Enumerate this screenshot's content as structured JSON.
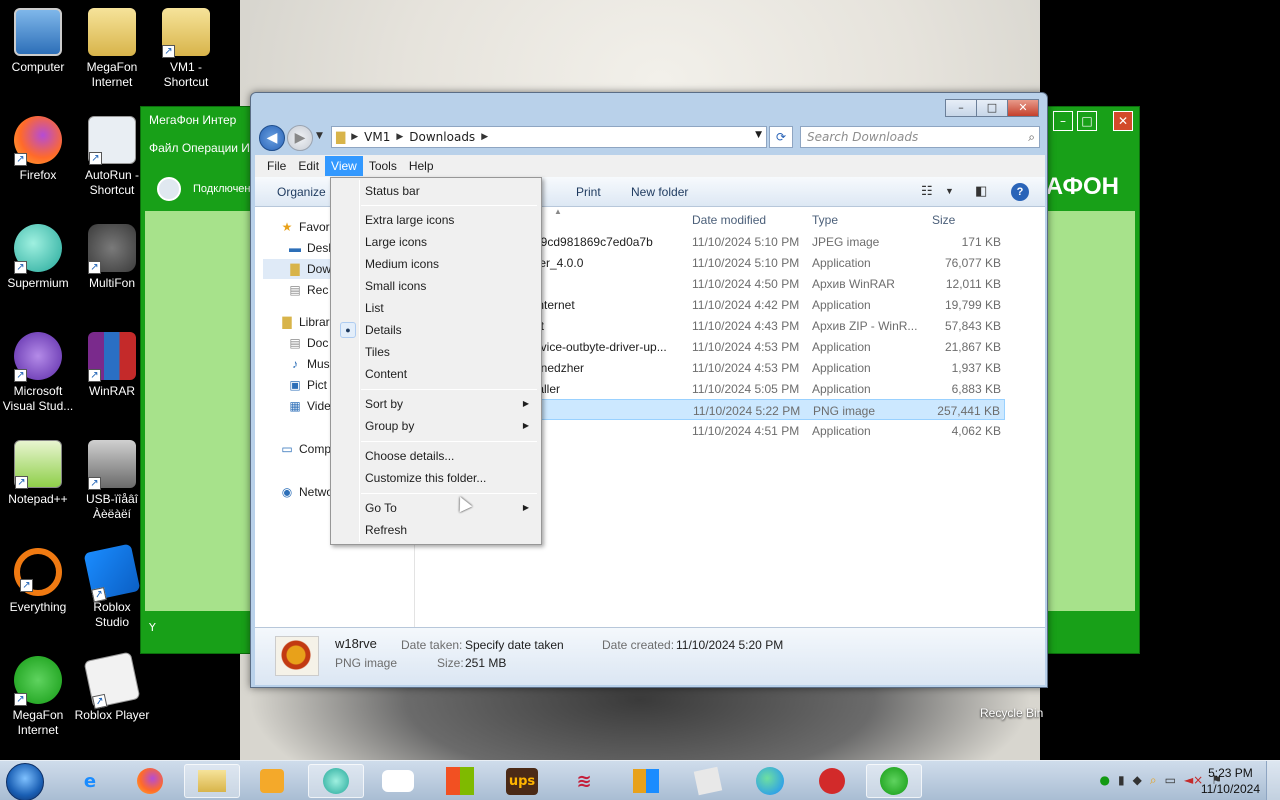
{
  "desktop": {
    "icons": [
      {
        "label1": "Computer",
        "label2": ""
      },
      {
        "label1": "MegaFon",
        "label2": "Internet"
      },
      {
        "label1": "VM1 -",
        "label2": "Shortcut"
      },
      {
        "label1": "Firefox",
        "label2": ""
      },
      {
        "label1": "AutoRun -",
        "label2": "Shortcut"
      },
      {
        "label1": "Supermium",
        "label2": ""
      },
      {
        "label1": "MultiFon",
        "label2": ""
      },
      {
        "label1": "Microsoft",
        "label2": "Visual Stud..."
      },
      {
        "label1": "WinRAR",
        "label2": ""
      },
      {
        "label1": "Notepad++",
        "label2": ""
      },
      {
        "label1": "USB-ïîåâî",
        "label2": "Àèëàëí"
      },
      {
        "label1": "Everything",
        "label2": ""
      },
      {
        "label1": "Roblox",
        "label2": "Studio"
      },
      {
        "label1": "MegaFon",
        "label2": "Internet"
      },
      {
        "label1": "Roblox Player",
        "label2": ""
      }
    ],
    "recycle_bin": "Recycle Bin"
  },
  "megafon_window": {
    "title": "МегаФон Интер",
    "menu": "Файл Операции И",
    "connect": "Подключен",
    "brand": "АФОН",
    "status": "Y"
  },
  "explorer": {
    "address": {
      "crumbs": [
        "VM1",
        "Downloads"
      ]
    },
    "search_placeholder": "Search Downloads",
    "menubar": [
      "File",
      "Edit",
      "View",
      "Tools",
      "Help"
    ],
    "toolbar": {
      "organize": "Organize",
      "print": "Print",
      "new_folder": "New folder"
    },
    "navpane": [
      "Favori",
      "Desl",
      "Dow",
      "Rec",
      "Librar",
      "Doc",
      "Mus",
      "Pict",
      "Vide",
      "Comp",
      "Netwo"
    ],
    "columns": {
      "date": "Date modified",
      "type": "Type",
      "size": "Size"
    },
    "files": [
      {
        "name": "e9cd981869c7ed0a7b",
        "date": "11/10/2024 5:10 PM",
        "type": "JPEG image",
        "size": "171 KB"
      },
      {
        "name": "ller_4.0.0",
        "date": "11/10/2024 5:10 PM",
        "type": "Application",
        "size": "76,077 KB"
      },
      {
        "name": "",
        "date": "11/10/2024 4:50 PM",
        "type": "Архив WinRAR",
        "size": "12,011 KB"
      },
      {
        "name": "Internet",
        "date": "11/10/2024 4:42 PM",
        "type": "Application",
        "size": "19,799 KB"
      },
      {
        "name": "et",
        "date": "11/10/2024 4:43 PM",
        "type": "Архив ZIP - WinR...",
        "size": "57,843 KB"
      },
      {
        "name": "evice-outbyte-driver-up...",
        "date": "11/10/2024 4:53 PM",
        "type": "Application",
        "size": "21,867 KB"
      },
      {
        "name": "enedzher",
        "date": "11/10/2024 4:53 PM",
        "type": "Application",
        "size": "1,937 KB"
      },
      {
        "name": "taller",
        "date": "11/10/2024 5:05 PM",
        "type": "Application",
        "size": "6,883 KB"
      },
      {
        "name": "",
        "date": "11/10/2024 5:22 PM",
        "type": "PNG image",
        "size": "257,441 KB"
      },
      {
        "name": "u",
        "date": "11/10/2024 4:51 PM",
        "type": "Application",
        "size": "4,062 KB"
      }
    ],
    "details": {
      "name": "w18rve",
      "kind": "PNG image",
      "date_taken_label": "Date taken:",
      "date_taken_value": "Specify date taken",
      "size_label": "Size:",
      "size_value": "251 MB",
      "date_created_label": "Date created:",
      "date_created_value": "11/10/2024 5:20 PM"
    }
  },
  "view_menu": {
    "items": [
      {
        "label": "Status bar"
      },
      {
        "label": "Extra large icons"
      },
      {
        "label": "Large icons"
      },
      {
        "label": "Medium icons"
      },
      {
        "label": "Small icons"
      },
      {
        "label": "List"
      },
      {
        "label": "Details",
        "selected": true
      },
      {
        "label": "Tiles"
      },
      {
        "label": "Content"
      },
      {
        "label": "Sort by",
        "submenu": true
      },
      {
        "label": "Group by",
        "submenu": true
      },
      {
        "label": "Choose details..."
      },
      {
        "label": "Customize this folder..."
      },
      {
        "label": "Go To",
        "submenu": true
      },
      {
        "label": "Refresh"
      }
    ]
  },
  "taskbar": {
    "clock_time": "5:23 PM",
    "clock_date": "11/10/2024"
  }
}
